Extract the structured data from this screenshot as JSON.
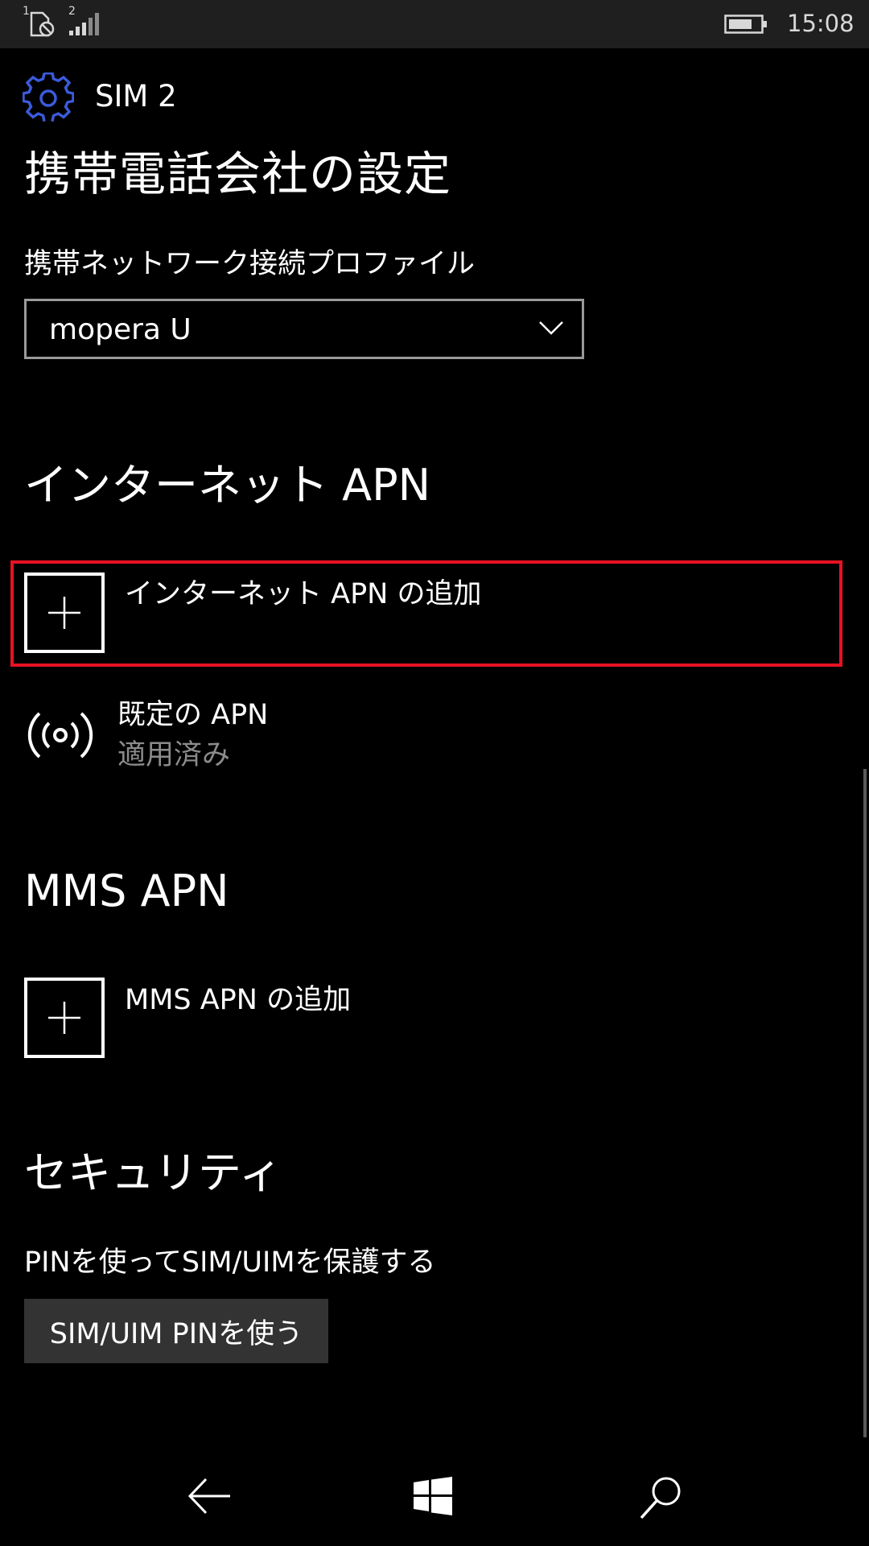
{
  "status_bar": {
    "sim1_indicator": "1",
    "sim2_indicator": "2",
    "time": "15:08",
    "icons": [
      "sim-no-signal-icon",
      "signal-bars-icon",
      "battery-icon"
    ]
  },
  "header": {
    "icon": "gear-icon",
    "title": "SIM 2",
    "accent_color": "#3b5bdb"
  },
  "page_title": "携帯電話会社の設定",
  "profile": {
    "label": "携帯ネットワーク接続プロファイル",
    "selected_value": "mopera U"
  },
  "internet_apn": {
    "section_title": "インターネット APN",
    "add_label": "インターネット APN の追加",
    "default_apn": {
      "icon": "broadcast-icon",
      "title": "既定の APN",
      "status": "適用済み"
    }
  },
  "mms_apn": {
    "section_title": "MMS APN",
    "add_label": "MMS APN の追加"
  },
  "security": {
    "section_title": "セキュリティ",
    "description": "PINを使ってSIM/UIMを保護する",
    "button_label": "SIM/UIM PINを使う"
  },
  "nav": {
    "icons": [
      "back-arrow-icon",
      "windows-start-icon",
      "search-icon"
    ]
  },
  "highlight_color": "#e81123"
}
